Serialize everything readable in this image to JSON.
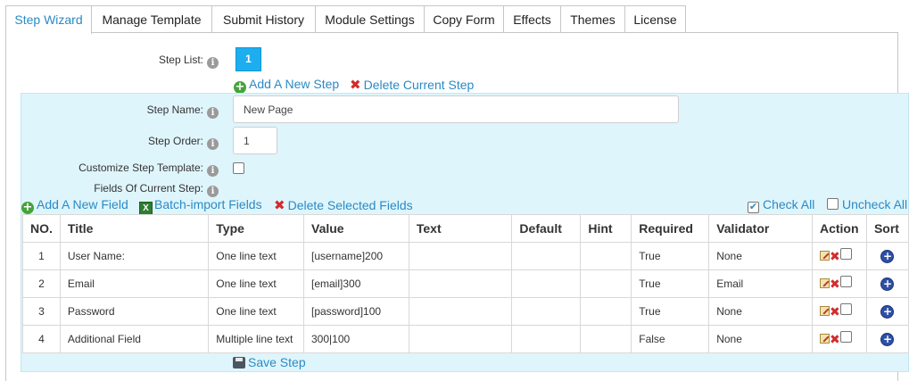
{
  "tabs": [
    {
      "label": "Step Wizard",
      "active": true
    },
    {
      "label": "Manage Template",
      "active": false
    },
    {
      "label": "Submit History",
      "active": false
    },
    {
      "label": "Module Settings",
      "active": false
    },
    {
      "label": "Copy Form",
      "active": false
    },
    {
      "label": "Effects",
      "active": false
    },
    {
      "label": "Themes",
      "active": false
    },
    {
      "label": "License",
      "active": false
    }
  ],
  "step_list": {
    "label": "Step List:",
    "steps": [
      "1"
    ],
    "add_step": "Add A New Step",
    "delete_step": "Delete Current Step"
  },
  "step_form": {
    "name_label": "Step Name:",
    "name_value": "New Page",
    "order_label": "Step Order:",
    "order_value": "1",
    "customize_label": "Customize Step Template:",
    "customize_checked": false,
    "fields_label": "Fields Of Current Step:"
  },
  "field_toolbar": {
    "add_field": "Add A New Field",
    "batch_import": "Batch-import Fields",
    "delete_selected": "Delete Selected Fields",
    "check_all": "Check All",
    "uncheck_all": "Uncheck All"
  },
  "table": {
    "columns": [
      "NO.",
      "Title",
      "Type",
      "Value",
      "Text",
      "Default",
      "Hint",
      "Required",
      "Validator",
      "Action",
      "Sort"
    ],
    "rows": [
      {
        "no": "1",
        "title": "User Name:",
        "type": "One line text",
        "value": "[username]200",
        "text": "",
        "default": "",
        "hint": "",
        "required": "True",
        "validator": "None"
      },
      {
        "no": "2",
        "title": "Email",
        "type": "One line text",
        "value": "[email]300",
        "text": "",
        "default": "",
        "hint": "",
        "required": "True",
        "validator": "Email"
      },
      {
        "no": "3",
        "title": "Password",
        "type": "One line text",
        "value": "[password]100",
        "text": "",
        "default": "",
        "hint": "",
        "required": "True",
        "validator": "None"
      },
      {
        "no": "4",
        "title": "Additional Field",
        "type": "Multiple line text",
        "value": "300|100",
        "text": "",
        "default": "",
        "hint": "",
        "required": "False",
        "validator": "None"
      }
    ]
  },
  "save_step": "Save Step",
  "icons": {
    "info": "info-icon",
    "add": "add-circle-icon",
    "delete": "red-x-icon",
    "excel": "excel-icon",
    "edit": "edit-icon",
    "sort": "sort-plus-icon",
    "save": "floppy-disk-icon"
  },
  "colors": {
    "link": "#2a8ac5",
    "step_button": "#1eaef0",
    "panel_bg": "#dff5fc",
    "delete_red": "#d22c2c",
    "add_green": "#46a33b"
  }
}
